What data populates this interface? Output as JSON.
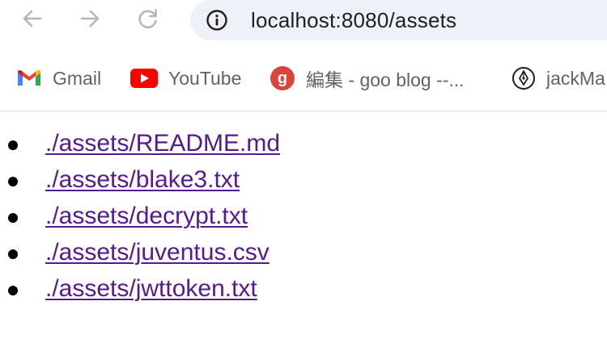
{
  "browser": {
    "url": "localhost:8080/assets",
    "nav": {
      "back_icon": "arrow-left-icon",
      "forward_icon": "arrow-right-icon",
      "reload_icon": "reload-icon",
      "site_info_icon": "info-circle-icon"
    },
    "bookmarks": [
      {
        "label": "Gmail",
        "icon": "gmail-icon"
      },
      {
        "label": "YouTube",
        "icon": "youtube-icon"
      },
      {
        "label": "編集 - goo blog --...",
        "icon": "goo-blog-icon"
      },
      {
        "label": "jackMa",
        "icon": "pen-nib-icon"
      }
    ]
  },
  "page": {
    "links": [
      {
        "text": "./assets/README.md"
      },
      {
        "text": "./assets/blake3.txt"
      },
      {
        "text": "./assets/decrypt.txt"
      },
      {
        "text": "./assets/juventus.csv"
      },
      {
        "text": "./assets/jwttoken.txt"
      }
    ]
  },
  "colors": {
    "visited_link": "#551a8b",
    "omnibox_bg": "#eef1f7",
    "youtube_red": "#ff0000",
    "goo_red": "#d9453a"
  }
}
